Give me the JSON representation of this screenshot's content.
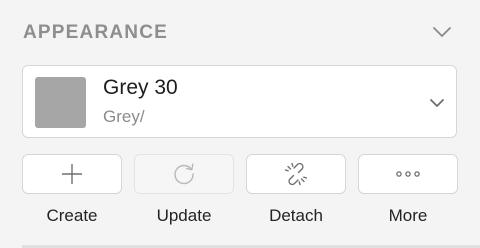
{
  "section": {
    "title": "APPEARANCE",
    "collapse_icon": "chevron-down-icon"
  },
  "style_selector": {
    "name": "Grey 30",
    "path": "Grey/",
    "swatch_color": "#a6a6a6",
    "dropdown_icon": "chevron-down-icon"
  },
  "actions": [
    {
      "label": "Create",
      "icon": "plus-icon",
      "enabled": true
    },
    {
      "label": "Update",
      "icon": "refresh-icon",
      "enabled": false
    },
    {
      "label": "Detach",
      "icon": "unlink-icon",
      "enabled": true
    },
    {
      "label": "More",
      "icon": "ellipsis-icon",
      "enabled": true
    }
  ]
}
